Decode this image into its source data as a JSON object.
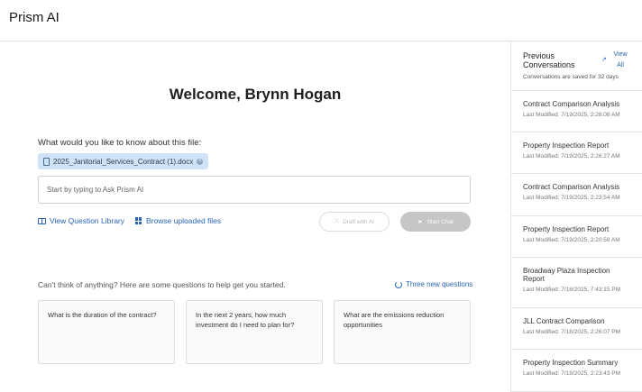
{
  "app": {
    "title": "Prism AI"
  },
  "main": {
    "welcome": "Welcome, Brynn Hogan",
    "ask_label": "What would you like to know about this file:",
    "file_name": "2025_Janitorial_Services_Contract (1).docx",
    "input": {
      "placeholder": "Start by typing to Ask Prism AI",
      "value": ""
    },
    "links": {
      "question_library": "View Question Library",
      "browse_files": "Browse uploaded files"
    },
    "buttons": {
      "draft": "Draft with AI",
      "start": "Start Chat"
    },
    "suggest_label": "Can't think of anything? Here are some questions to help get you started.",
    "refresh_label": "Three new questions",
    "questions": [
      "What is the duration of the contract?",
      "In the next 2 years, how much investment do I need to plan for?",
      "What are the emissions reduction opportunities"
    ]
  },
  "sidebar": {
    "title": "Previous Conversations",
    "view_all": "View All",
    "note": "Conversations are saved for 32 days",
    "conversations": [
      {
        "title": "Contract Comparison Analysis",
        "modified": "Last Modified: 7/19/2025, 2:28:08 AM"
      },
      {
        "title": "Property Inspection Report",
        "modified": "Last Modified: 7/19/2025, 2:26:27 AM"
      },
      {
        "title": "Contract Comparison Analysis",
        "modified": "Last Modified: 7/19/2025, 2:23:54 AM"
      },
      {
        "title": "Property Inspection Report",
        "modified": "Last Modified: 7/19/2025, 2:20:58 AM"
      },
      {
        "title": "Broadway Plaza Inspection Report",
        "modified": "Last Modified: 7/18/2025, 7:43:15 PM"
      },
      {
        "title": "JLL Contract Comparison",
        "modified": "Last Modified: 7/18/2025, 2:26:07 PM"
      },
      {
        "title": "Property Inspection Summary",
        "modified": "Last Modified: 7/18/2025, 2:23:43 PM"
      }
    ]
  },
  "colors": {
    "link": "#2a64b5",
    "chip": "#cfe2f7",
    "start_button": "#c6c6c6"
  }
}
